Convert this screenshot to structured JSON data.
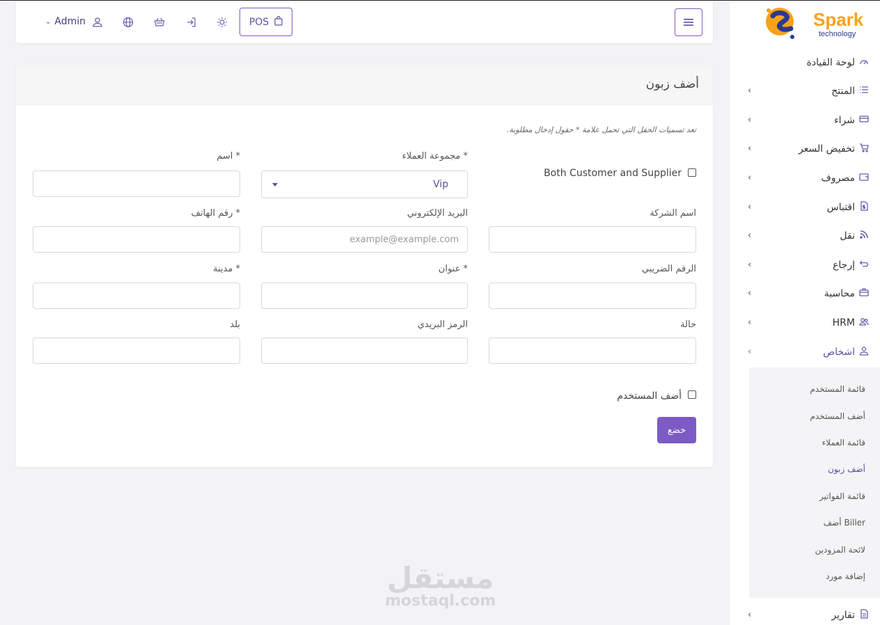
{
  "topbar": {
    "pos_label": "POS",
    "user_label": "Admin"
  },
  "form": {
    "title": "أضف زبون",
    "required_note": "تعد تسميات الحقل التي تحمل علامة * حقول إدخال مطلوبة.",
    "both_label": "Both Customer and Supplier",
    "group_label": "مجموعة العملاء *",
    "group_value": "Vip",
    "name_label": "اسم *",
    "company_label": "اسم الشركة",
    "email_label": "البريد الإلكتروني",
    "email_placeholder": "example@example.com",
    "phone_label": "رقم الهاتف *",
    "tax_label": "الرقم الضريبي",
    "address_label": "عنوان *",
    "city_label": "مدينة *",
    "state_label": "حالة",
    "postal_label": "الرمز البريدي",
    "country_label": "بلد",
    "add_user_label": "أضف المستخدم",
    "submit_label": "خضع"
  },
  "watermark": {
    "arabic": "مستقل",
    "latin": "mostaql.com"
  },
  "sidebar": {
    "brand": "Spark",
    "brand_sub": "technology",
    "items": [
      {
        "label": "لوحة القيادة",
        "icon": "gauge-icon"
      },
      {
        "label": "المنتج",
        "icon": "list-icon"
      },
      {
        "label": "شراء",
        "icon": "card-icon"
      },
      {
        "label": "تخفيض السعر",
        "icon": "cart-icon"
      },
      {
        "label": "مصروف",
        "icon": "wallet-icon"
      },
      {
        "label": "اقتباس",
        "icon": "file-dollar-icon"
      },
      {
        "label": "نقل",
        "icon": "rss-icon"
      },
      {
        "label": "إرجاع",
        "icon": "return-icon"
      },
      {
        "label": "محاسبة",
        "icon": "briefcase-icon"
      },
      {
        "label": "HRM",
        "icon": "users-icon"
      },
      {
        "label": "اشخاص",
        "icon": "user-icon"
      },
      {
        "label": "تقارير",
        "icon": "report-icon"
      }
    ],
    "sub_items": [
      {
        "label": "قائمة المستخدم"
      },
      {
        "label": "أضف المستخدم"
      },
      {
        "label": "قائمة العملاء"
      },
      {
        "label": "أضف زبون"
      },
      {
        "label": "قائمة الفواتير"
      },
      {
        "label": "أضف Biller"
      },
      {
        "label": "لائحة المزودين"
      },
      {
        "label": "إضافة مورد"
      }
    ],
    "accent": "#7c5cc4"
  }
}
